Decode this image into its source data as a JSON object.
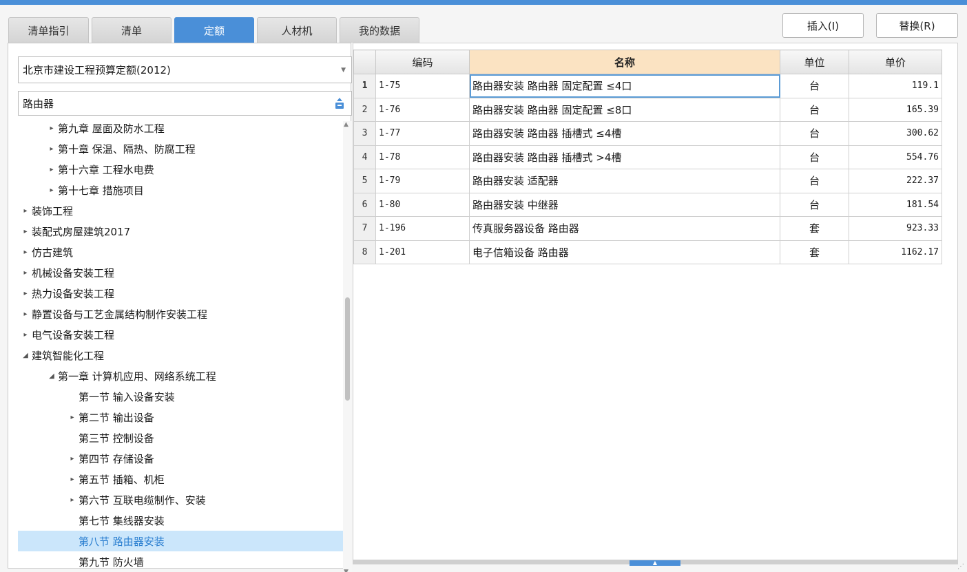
{
  "tabs": [
    {
      "label": "清单指引",
      "active": false
    },
    {
      "label": "清单",
      "active": false
    },
    {
      "label": "定额",
      "active": true
    },
    {
      "label": "人材机",
      "active": false
    },
    {
      "label": "我的数据",
      "active": false
    }
  ],
  "buttons": {
    "insert": "插入(I)",
    "replace": "替换(R)"
  },
  "left": {
    "dropdown_value": "北京市建设工程预算定额(2012)",
    "search_value": "路由器",
    "tree": [
      {
        "label": "第九章 屋面及防水工程",
        "level": 1,
        "toggle": "▸"
      },
      {
        "label": "第十章 保温、隔热、防腐工程",
        "level": 1,
        "toggle": "▸"
      },
      {
        "label": "第十六章 工程水电费",
        "level": 1,
        "toggle": "▸"
      },
      {
        "label": "第十七章 措施项目",
        "level": 1,
        "toggle": "▸"
      },
      {
        "label": "装饰工程",
        "level": 0,
        "toggle": "▸"
      },
      {
        "label": "装配式房屋建筑2017",
        "level": 0,
        "toggle": "▸"
      },
      {
        "label": "仿古建筑",
        "level": 0,
        "toggle": "▸"
      },
      {
        "label": "机械设备安装工程",
        "level": 0,
        "toggle": "▸"
      },
      {
        "label": "热力设备安装工程",
        "level": 0,
        "toggle": "▸"
      },
      {
        "label": "静置设备与工艺金属结构制作安装工程",
        "level": 0,
        "toggle": "▸"
      },
      {
        "label": "电气设备安装工程",
        "level": 0,
        "toggle": "▸"
      },
      {
        "label": "建筑智能化工程",
        "level": 0,
        "toggle": "◢"
      },
      {
        "label": "第一章 计算机应用、网络系统工程",
        "level": 1,
        "toggle": "◢"
      },
      {
        "label": "第一节 输入设备安装",
        "level": 2,
        "toggle": ""
      },
      {
        "label": "第二节 输出设备",
        "level": 2,
        "toggle": "▸"
      },
      {
        "label": "第三节 控制设备",
        "level": 2,
        "toggle": ""
      },
      {
        "label": "第四节 存储设备",
        "level": 2,
        "toggle": "▸"
      },
      {
        "label": "第五节 插箱、机柜",
        "level": 2,
        "toggle": "▸"
      },
      {
        "label": "第六节 互联电缆制作、安装",
        "level": 2,
        "toggle": "▸"
      },
      {
        "label": "第七节 集线器安装",
        "level": 2,
        "toggle": ""
      },
      {
        "label": "第八节 路由器安装",
        "level": 2,
        "toggle": "",
        "selected": true
      },
      {
        "label": "第九节 防火墙",
        "level": 2,
        "toggle": ""
      }
    ]
  },
  "grid": {
    "columns": [
      "编码",
      "名称",
      "单位",
      "单价"
    ],
    "rows": [
      {
        "no": "1",
        "code": "1-75",
        "name": "路由器安装 路由器 固定配置 ≤4口",
        "unit": "台",
        "price": "119.1"
      },
      {
        "no": "2",
        "code": "1-76",
        "name": "路由器安装 路由器 固定配置 ≤8口",
        "unit": "台",
        "price": "165.39"
      },
      {
        "no": "3",
        "code": "1-77",
        "name": "路由器安装 路由器 插槽式 ≤4槽",
        "unit": "台",
        "price": "300.62"
      },
      {
        "no": "4",
        "code": "1-78",
        "name": "路由器安装 路由器 插槽式 >4槽",
        "unit": "台",
        "price": "554.76"
      },
      {
        "no": "5",
        "code": "1-79",
        "name": "路由器安装 适配器",
        "unit": "台",
        "price": "222.37"
      },
      {
        "no": "6",
        "code": "1-80",
        "name": "路由器安装 中继器",
        "unit": "台",
        "price": "181.54"
      },
      {
        "no": "7",
        "code": "1-196",
        "name": "传真服务器设备 路由器",
        "unit": "套",
        "price": "923.33"
      },
      {
        "no": "8",
        "code": "1-201",
        "name": "电子信箱设备 路由器",
        "unit": "套",
        "price": "1162.17"
      }
    ]
  },
  "colors": {
    "accent": "#4a8fd8",
    "header_highlight": "#fbe3c2",
    "selection": "#cbe6fb"
  },
  "icons": {
    "search_button": "locate-icon",
    "dropdown": "chevron-down-icon",
    "tree_collapsed": "caret-right-icon",
    "tree_expanded": "caret-down-icon"
  }
}
